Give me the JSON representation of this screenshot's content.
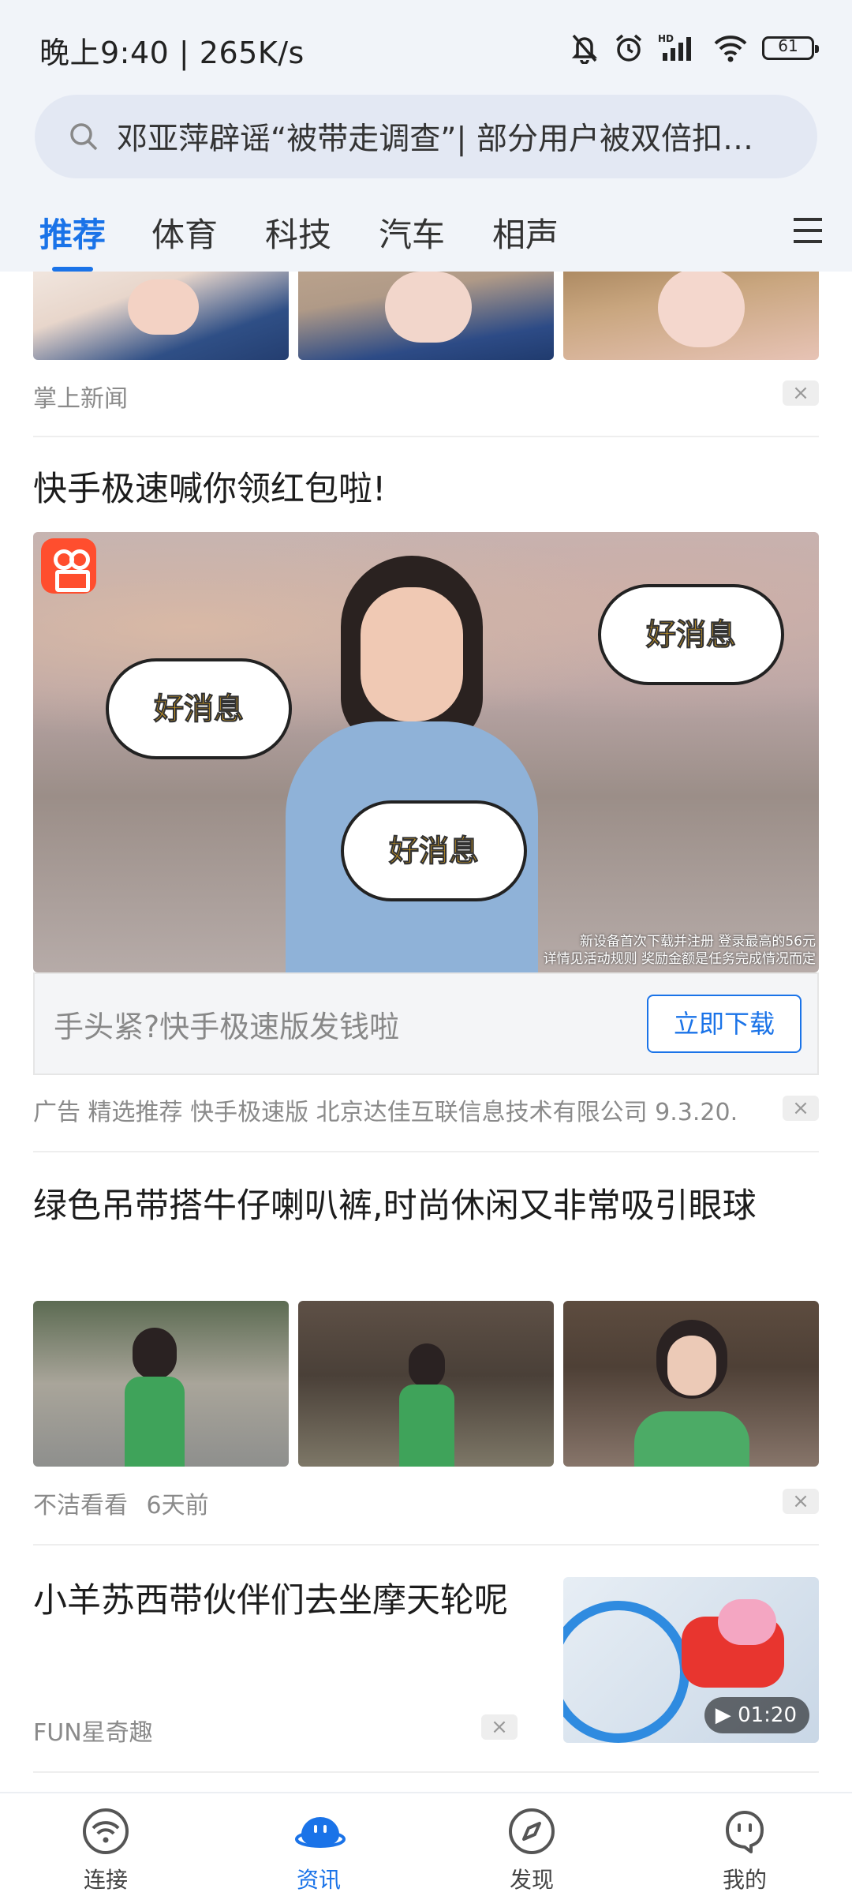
{
  "status_bar": {
    "time": "晚上9:40 | 265K/s",
    "battery": "61",
    "icons": [
      "mute-bell-icon",
      "alarm-icon",
      "hd-signal-icon",
      "wifi-icon",
      "battery-icon"
    ]
  },
  "search": {
    "query": "邓亚萍辟谣“被带走调查”| 部分用户被双倍扣…"
  },
  "tabs": [
    {
      "label": "推荐",
      "active": true
    },
    {
      "label": "体育",
      "active": false
    },
    {
      "label": "科技",
      "active": false
    },
    {
      "label": "汽车",
      "active": false
    },
    {
      "label": "相声",
      "active": false
    }
  ],
  "feed": {
    "item1": {
      "source": "掌上新闻"
    },
    "ad": {
      "title": "快手极速喊你领红包啦!",
      "bubble_text": "好消息",
      "fine_print_1": "新设备首次下载并注册 登录最高的56元",
      "fine_print_2": "详情见活动规则 奖励金额是任务完成情况而定",
      "cta_text": "手头紧?快手极速版发钱啦",
      "cta_button": "立即下载",
      "meta": "广告  精选推荐  快手极速版 北京达佳互联信息技术有限公司 9.3.20."
    },
    "item3": {
      "title": "绿色吊带搭牛仔喇叭裤,时尚休闲又非常吸引眼球",
      "source": "不洁看看",
      "time": "6天前"
    },
    "item4": {
      "title": "小羊苏西带伙伴们去坐摩天轮呢",
      "source": "FUN星奇趣",
      "duration": "01:20"
    },
    "close_symbol": "×"
  },
  "bottom_nav": [
    {
      "label": "连接",
      "icon": "wifi-connect-icon",
      "active": false
    },
    {
      "label": "资讯",
      "icon": "news-face-icon",
      "active": true
    },
    {
      "label": "发现",
      "icon": "compass-icon",
      "active": false
    },
    {
      "label": "我的",
      "icon": "profile-face-icon",
      "active": false
    }
  ],
  "colors": {
    "accent": "#1a73e8",
    "header_bg": "#f1f4f9",
    "search_bg": "#e3e8f3"
  }
}
